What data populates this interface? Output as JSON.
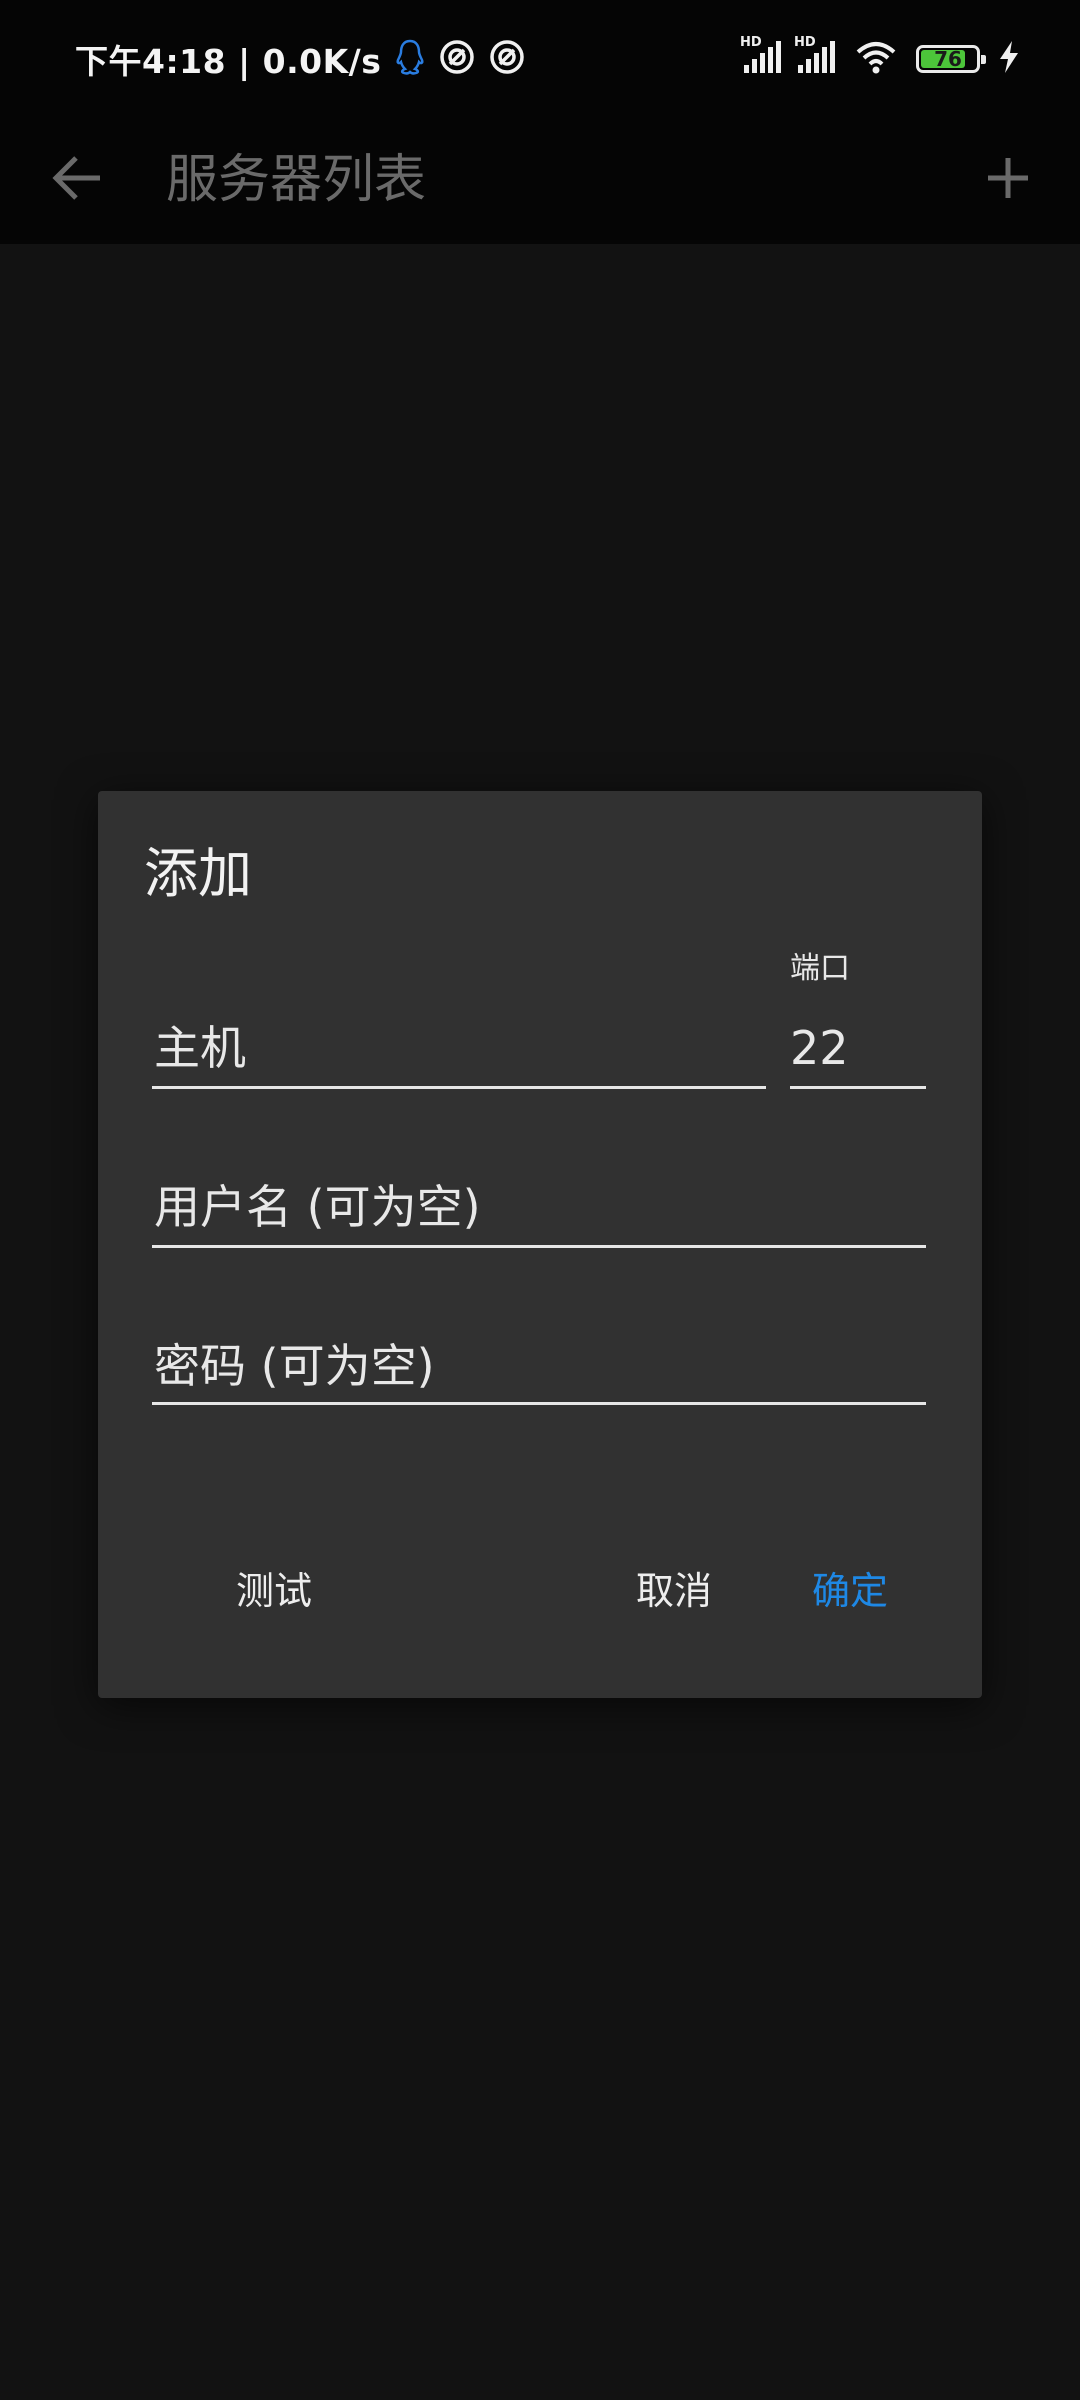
{
  "status_bar": {
    "time_speed": "下午4:18 | 0.0K/s",
    "battery_level": "76",
    "icons": [
      "qq-icon",
      "sync-icon",
      "sync-icon",
      "hd-signal-icon",
      "hd-signal-icon",
      "wifi-icon",
      "battery-icon",
      "charging-icon"
    ],
    "hd_label": "HD",
    "colors": {
      "qq": "#2a7de1",
      "battery_fill": "#4cc53a"
    }
  },
  "app_bar": {
    "title": "服务器列表",
    "back_icon": "arrow-left-icon",
    "add_icon": "plus-icon"
  },
  "dialog": {
    "title": "添加",
    "host": {
      "placeholder": "主机",
      "value": ""
    },
    "port": {
      "label": "端口",
      "value": "22"
    },
    "username": {
      "placeholder": "用户名 (可为空)",
      "value": ""
    },
    "password": {
      "placeholder": "密码 (可为空)",
      "value": ""
    },
    "buttons": {
      "test": "测试",
      "cancel": "取消",
      "confirm": "确定"
    },
    "colors": {
      "confirm": "#1e88e5",
      "background": "#313131"
    }
  }
}
